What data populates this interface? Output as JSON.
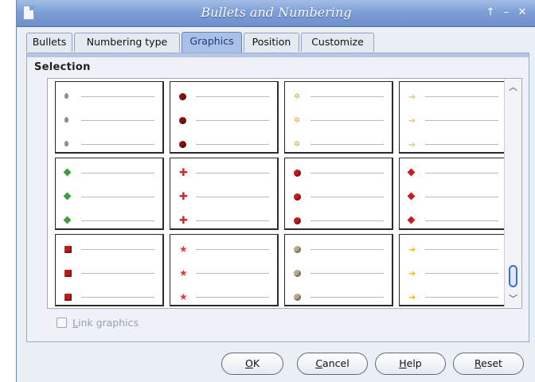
{
  "window": {
    "title": "Bullets and Numbering",
    "controls": {
      "up": "↑",
      "minimize": "–",
      "close": "✕"
    }
  },
  "tabs": [
    {
      "label": "Bullets",
      "active": false
    },
    {
      "label": "Numbering type",
      "active": false
    },
    {
      "label": "Graphics",
      "active": true
    },
    {
      "label": "Position",
      "active": false
    },
    {
      "label": "Customize",
      "active": false
    }
  ],
  "selection": {
    "label": "Selection",
    "cells": [
      {
        "bullet": "small-gray-bullet",
        "color": "#8a8f9a"
      },
      {
        "bullet": "dark-red-ball-bullet",
        "color": "#8a1010"
      },
      {
        "bullet": "gold-swirl-bullet",
        "color": "#d8b040"
      },
      {
        "bullet": "pale-gold-arrow-bullet",
        "color": "#e6c88a"
      },
      {
        "bullet": "multicolor-diamond-bullet",
        "color": "#3aa03a"
      },
      {
        "bullet": "red-cross-bullet",
        "color": "#d42828"
      },
      {
        "bullet": "red-sphere-bullet",
        "color": "#c81818"
      },
      {
        "bullet": "red-diamond-bullet",
        "color": "#c02020"
      },
      {
        "bullet": "red-cube-bullet",
        "color": "#c41818"
      },
      {
        "bullet": "red-star-bullet",
        "color": "#d84040"
      },
      {
        "bullet": "beige-pin-bullet",
        "color": "#b8a888"
      },
      {
        "bullet": "yellow-arrow-bullet",
        "color": "#e8c020"
      }
    ]
  },
  "link_graphics": {
    "label": "Link graphics",
    "checked": false,
    "enabled": false
  },
  "buttons": {
    "ok": "OK",
    "cancel": "Cancel",
    "help": "Help",
    "reset": "Reset"
  }
}
